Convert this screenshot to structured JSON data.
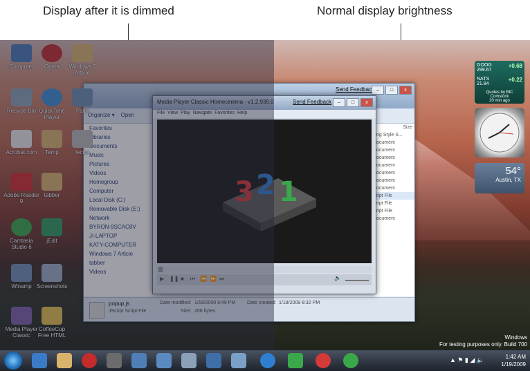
{
  "captions": {
    "left": "Display after it is dimmed",
    "right": "Normal display brightness"
  },
  "desktop_icons": [
    {
      "label": "Computer"
    },
    {
      "label": "Opera"
    },
    {
      "label": "Windows 7 Article"
    },
    {
      "label": "Recycle Bin"
    },
    {
      "label": "QuickTime Player"
    },
    {
      "label": "Paint"
    },
    {
      "label": "Acrobat.com"
    },
    {
      "label": "Temp"
    },
    {
      "label": "lectur"
    },
    {
      "label": "Adobe Reader 9"
    },
    {
      "label": "tabber"
    },
    {
      "label": "Camtasia Studio 6"
    },
    {
      "label": "jEdit"
    },
    {
      "label": "Winamp"
    },
    {
      "label": "Screenshots"
    },
    {
      "label": "Media Player Classic"
    },
    {
      "label": "CoffeeCup Free HTML"
    }
  ],
  "explorer": {
    "send_feedback": "Send Feedback",
    "toolbar": [
      "Organize ▾",
      "Open"
    ],
    "nav": [
      "Favorites",
      "Libraries",
      "Documents",
      "Music",
      "Pictures",
      "Videos",
      "Homegroup",
      "Computer",
      "Local Disk (C:)",
      "Removable Disk (E:)",
      "Network",
      "BYRON-9SCAC8V",
      "JI-LAPTOP",
      "KATY-COMPUTER",
      "Windows 7 Article",
      "tabber",
      "Videos"
    ],
    "right_header": "Size",
    "right_items": [
      "ng Style S...",
      "ocument",
      "ocument",
      "ocument",
      "ocument",
      "ocument",
      "ocument",
      "ocument",
      "ript File",
      "ript File",
      "ript File",
      "ocument"
    ],
    "status": {
      "file_name": "popup.js",
      "file_type": "JScript Script File",
      "date_modified_label": "Date modified:",
      "date_modified": "1/18/2009 8:49 PM",
      "date_created_label": "Date created:",
      "date_created": "1/18/2009 8:32 PM",
      "size_label": "Size:",
      "size": "208 bytes"
    }
  },
  "mpc": {
    "title": "Media Player Classic Homecinema - v1.2.939.0",
    "send_feedback": "Send Feedback",
    "menu": [
      "File",
      "View",
      "Play",
      "Navigate",
      "Favorites",
      "Help"
    ],
    "logo_text": "321"
  },
  "gadgets": {
    "stocks": [
      {
        "symbol": "GOOG",
        "price": "299.67",
        "change": "+0.68"
      },
      {
        "symbol": "NATS",
        "price": "21.84",
        "change": "+0.22"
      }
    ],
    "stocks_footer": "Quotes by BIC Comstock",
    "stocks_delay": "20 min ago",
    "weather": {
      "temp": "54°",
      "city": "Austin, TX"
    }
  },
  "watermark": {
    "line1": "Windows",
    "line2": "For testing purposes only. Build 700"
  },
  "taskbar": {
    "time": "1:42 AM",
    "date": "1/19/2009"
  },
  "colors": {
    "dim_overlay": "#28283c",
    "accent": "#1f6fb8"
  }
}
